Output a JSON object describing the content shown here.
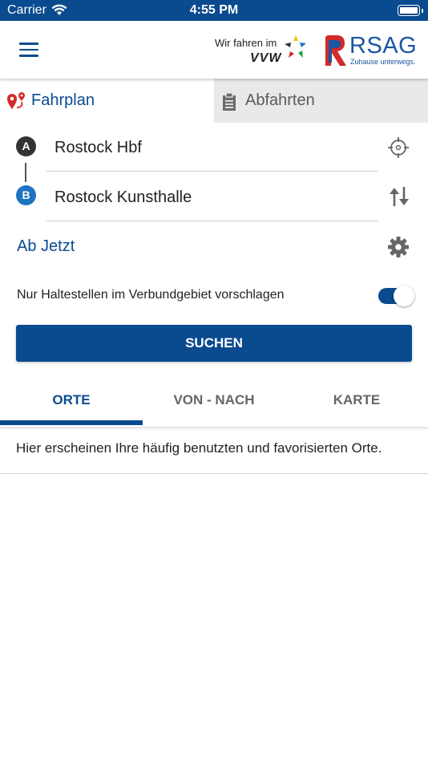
{
  "status_bar": {
    "carrier": "Carrier",
    "time": "4:55 PM"
  },
  "header": {
    "vvw_text": "Wir fahren im",
    "vvw_brand": "VVW",
    "rsag_name": "RSAG",
    "rsag_tagline": "Zuhause unterwegs."
  },
  "top_tabs": {
    "fahrplan": "Fahrplan",
    "abfahrten": "Abfahrten",
    "active": "fahrplan"
  },
  "route": {
    "from_badge": "A",
    "from": "Rostock Hbf",
    "to_badge": "B",
    "to": "Rostock Kunsthalle"
  },
  "time_option": "Ab Jetzt",
  "toggle": {
    "label": "Nur Haltestellen im Verbundgebiet vorschlagen",
    "on": true
  },
  "search_button": "SUCHEN",
  "sub_tabs": {
    "orte": "ORTE",
    "von_nach": "VON - NACH",
    "karte": "KARTE",
    "active": "orte"
  },
  "info_text": "Hier erscheinen Ihre häufig benutzten und favorisierten Orte.",
  "colors": {
    "primary": "#0a4a8f",
    "badge_a": "#333333",
    "badge_b": "#1f74c2",
    "inactive_tab": "#e9e9e9"
  }
}
